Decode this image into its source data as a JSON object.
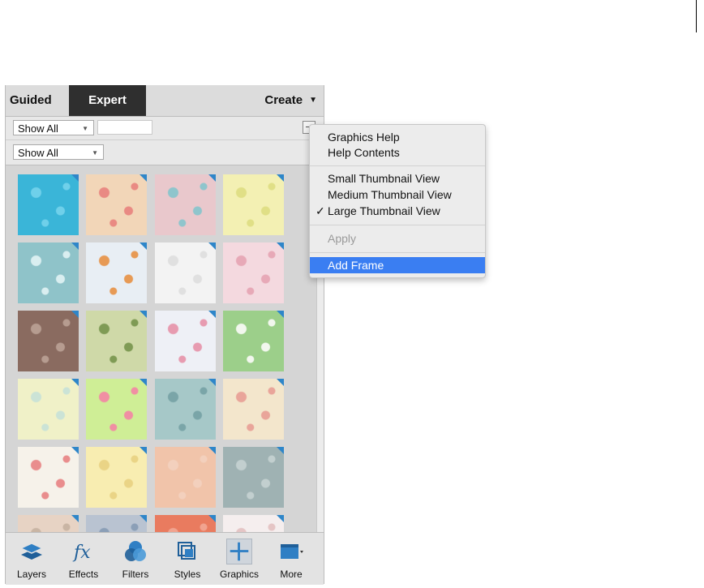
{
  "tabs": {
    "guided": "Guided",
    "expert": "Expert",
    "create": "Create"
  },
  "filters": {
    "filter1": "Show All",
    "filter2": "Show All",
    "search_value": ""
  },
  "menu": {
    "items": [
      {
        "label": "Graphics Help",
        "state": "normal"
      },
      {
        "label": "Help Contents",
        "state": "normal"
      },
      {
        "label": "Small Thumbnail View",
        "state": "normal"
      },
      {
        "label": "Medium Thumbnail View",
        "state": "normal"
      },
      {
        "label": "Large Thumbnail View",
        "state": "checked"
      },
      {
        "label": "Apply",
        "state": "disabled"
      },
      {
        "label": "Add Frame",
        "state": "highlighted"
      }
    ],
    "checkmark": "✓"
  },
  "toolbar": {
    "layers": "Layers",
    "effects": "Effects",
    "filters": "Filters",
    "styles": "Styles",
    "graphics": "Graphics",
    "more": "More"
  },
  "thumbnails": [
    {
      "name": "blue-watercolor",
      "bg": "#3ab5d8",
      "fg": "#6fd0ea"
    },
    {
      "name": "pastel-flowers",
      "bg": "#f2d6b8",
      "fg": "#e98a83"
    },
    {
      "name": "pink-watercolor",
      "bg": "#e9c8cc",
      "fg": "#8fc5cc"
    },
    {
      "name": "yellow-burst",
      "bg": "#f3f0b3",
      "fg": "#e0df86"
    },
    {
      "name": "teal-dots",
      "bg": "#8fc3c9",
      "fg": "#d9eef0"
    },
    {
      "name": "autumn-leaves",
      "bg": "#e8eef4",
      "fg": "#e79a55"
    },
    {
      "name": "balloons-white",
      "bg": "#f3f3f3",
      "fg": "#e0e0e0"
    },
    {
      "name": "pink-speckle",
      "bg": "#f4d9df",
      "fg": "#e7a9b7"
    },
    {
      "name": "brick-wall",
      "bg": "#8a6b60",
      "fg": "#b69c90"
    },
    {
      "name": "green-rays",
      "bg": "#cfd9a8",
      "fg": "#7f9b55"
    },
    {
      "name": "pink-hearts",
      "bg": "#eef0f6",
      "fg": "#e79bb0"
    },
    {
      "name": "green-daisies",
      "bg": "#9ccf8a",
      "fg": "#f2f7ee"
    },
    {
      "name": "yellow-stripes",
      "bg": "#f0f1c8",
      "fg": "#cbe3d6"
    },
    {
      "name": "lime-dots",
      "bg": "#cfee96",
      "fg": "#f08fa3"
    },
    {
      "name": "teal-flowers",
      "bg": "#a6c8c8",
      "fg": "#7aa5a8"
    },
    {
      "name": "circles-cream",
      "bg": "#f3e6cc",
      "fg": "#e9a59a"
    },
    {
      "name": "confetti-white",
      "bg": "#f6f2ea",
      "fg": "#e98d8d"
    },
    {
      "name": "yellow-dots",
      "bg": "#f8edb1",
      "fg": "#ead486"
    },
    {
      "name": "peach-plain",
      "bg": "#f1c4aa",
      "fg": "#f3d0bd"
    },
    {
      "name": "grey-texture",
      "bg": "#9fb2b3",
      "fg": "#c2cfcf"
    },
    {
      "name": "partial-1",
      "bg": "#e7d3c4",
      "fg": "#c9b5a4"
    },
    {
      "name": "partial-2",
      "bg": "#b9c3d1",
      "fg": "#8b9fb7"
    },
    {
      "name": "partial-3",
      "bg": "#e97b5f",
      "fg": "#f1a38f"
    },
    {
      "name": "partial-4",
      "bg": "#f5eeee",
      "fg": "#e5c5c5"
    }
  ]
}
